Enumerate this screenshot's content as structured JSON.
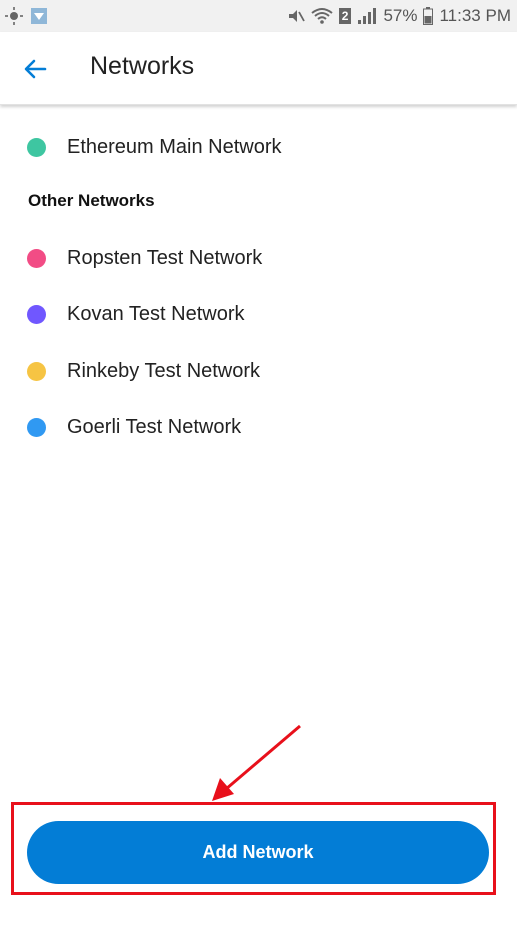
{
  "status_bar": {
    "sim_badge": "2",
    "battery_percent": "57%",
    "time": "11:33 PM"
  },
  "header": {
    "title": "Networks"
  },
  "networks": {
    "main": {
      "label": "Ethereum Main Network",
      "color": "#3ec6a1"
    },
    "section_label": "Other Networks",
    "others": [
      {
        "label": "Ropsten Test Network",
        "color": "#f24c85"
      },
      {
        "label": "Kovan Test Network",
        "color": "#7057ff"
      },
      {
        "label": "Rinkeby Test Network",
        "color": "#f6c443"
      },
      {
        "label": "Goerli Test Network",
        "color": "#3099f2"
      }
    ]
  },
  "footer": {
    "add_network_label": "Add Network"
  },
  "colors": {
    "accent": "#037dd6",
    "annotation_red": "#e8101b"
  }
}
